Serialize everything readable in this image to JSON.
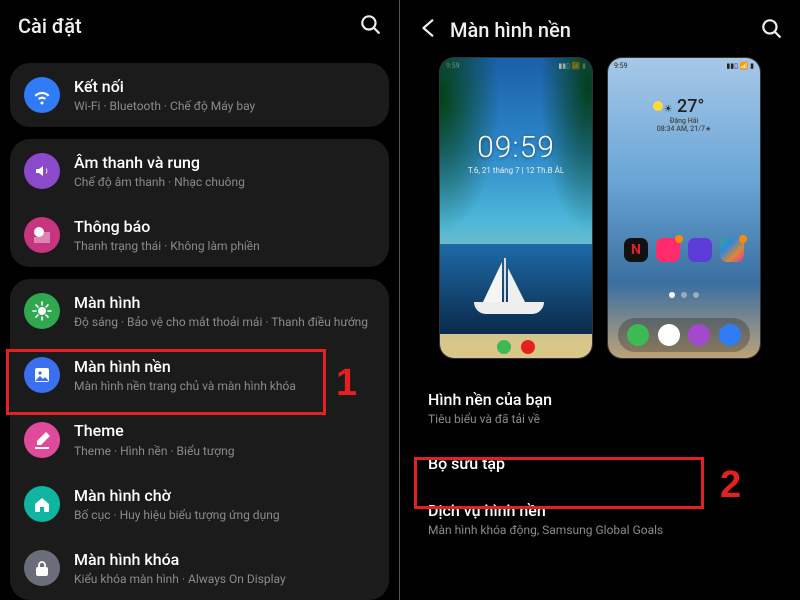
{
  "left": {
    "title": "Cài đặt",
    "groups": [
      [
        {
          "key": "connections",
          "icon": "wifi",
          "bg": "bg-blue",
          "title": "Kết nối",
          "sub": "Wi-Fi  ·  Bluetooth  ·  Chế độ Máy bay"
        }
      ],
      [
        {
          "key": "sound",
          "icon": "sound",
          "bg": "bg-purple",
          "title": "Âm thanh và rung",
          "sub": "Chế độ âm thanh  ·  Nhạc chuông"
        },
        {
          "key": "notify",
          "icon": "notify",
          "bg": "bg-magenta",
          "title": "Thông báo",
          "sub": "Thanh trạng thái  ·  Không làm phiền"
        }
      ],
      [
        {
          "key": "display",
          "icon": "display",
          "bg": "bg-green",
          "title": "Màn hình",
          "sub": "Độ sáng  ·  Bảo vệ cho mắt thoải mái  ·  Thanh điều hướng"
        },
        {
          "key": "wallpaper",
          "icon": "wallpaper",
          "bg": "bg-bluepic",
          "title": "Màn hình nền",
          "sub": "Màn hình nền trang chủ và màn hình khóa"
        },
        {
          "key": "theme",
          "icon": "theme",
          "bg": "bg-brush",
          "title": "Theme",
          "sub": "Theme  ·  Hình nền  ·  Biểu tượng"
        },
        {
          "key": "home",
          "icon": "home",
          "bg": "bg-teal",
          "title": "Màn hình chờ",
          "sub": "Bố cục  ·  Huy hiệu biểu tượng ứng dụng"
        },
        {
          "key": "lock",
          "icon": "lock",
          "bg": "bg-lock",
          "title": "Màn hình khóa",
          "sub": "Kiểu khóa màn hình  ·  Always On Display"
        }
      ]
    ],
    "step_label": "1"
  },
  "right": {
    "title": "Màn hình nền",
    "preview_clock": "09:59",
    "preview_date": "T.6, 21 tháng 7 | 12 Th.B ÂL",
    "preview_temp": "27°",
    "preview_loc": "Đặng Hải",
    "preview_hi_lo": "08:34 AM, 21/7★",
    "menu": [
      {
        "key": "yours",
        "title": "Hình nền của bạn",
        "sub": "Tiêu biểu và đã tải về"
      },
      {
        "key": "gallery",
        "title": "Bộ sưu tập",
        "sub": ""
      },
      {
        "key": "services",
        "title": "Dịch vụ hình nền",
        "sub": "Màn hình khóa động, Samsung Global Goals"
      }
    ],
    "step_label": "2"
  }
}
